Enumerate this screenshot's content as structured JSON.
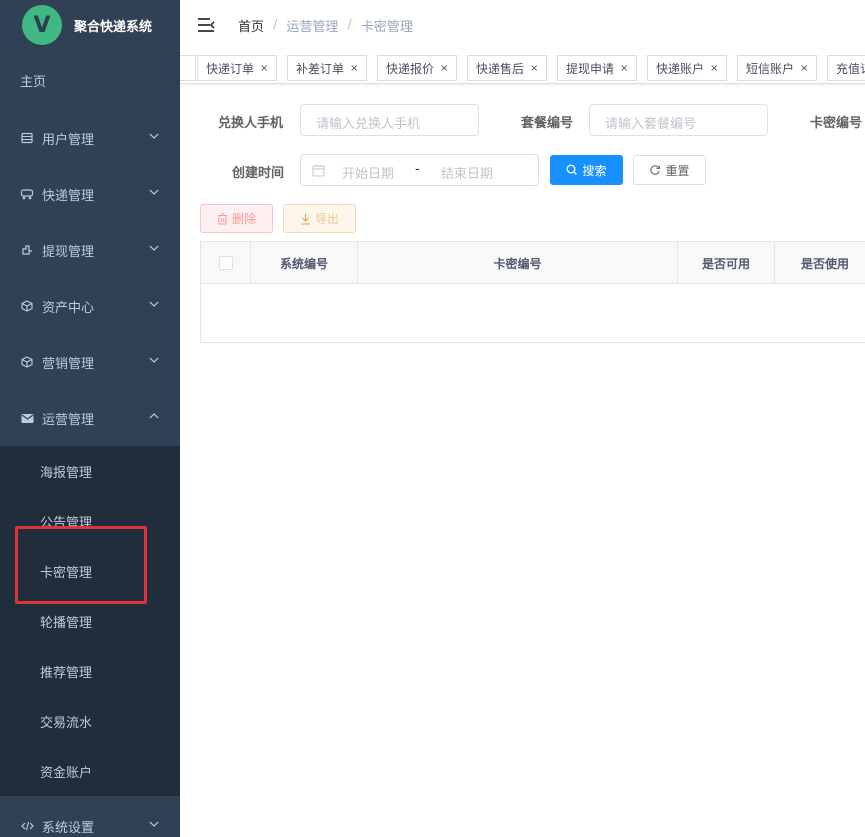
{
  "app": {
    "logo_letter": "V",
    "title": "聚合快递系统"
  },
  "sidebar": {
    "home": "主页",
    "items": [
      {
        "label": "用户管理",
        "icon": "table-icon"
      },
      {
        "label": "快递管理",
        "icon": "truck-icon"
      },
      {
        "label": "提现管理",
        "icon": "withdraw-icon"
      },
      {
        "label": "资产中心",
        "icon": "cube-icon"
      },
      {
        "label": "营销管理",
        "icon": "cube-icon"
      },
      {
        "label": "运营管理",
        "icon": "mail-icon"
      }
    ],
    "sub_items": [
      "海报管理",
      "公告管理",
      "卡密管理",
      "轮播管理",
      "推荐管理",
      "交易流水",
      "资金账户"
    ],
    "bottom_item": {
      "label": "系统设置",
      "icon": "code-icon"
    }
  },
  "breadcrumb": [
    "首页",
    "运营管理",
    "卡密管理"
  ],
  "tags": [
    "快递订单",
    "补差订单",
    "快递报价",
    "快递售后",
    "提现申请",
    "快递账户",
    "短信账户",
    "充值订单"
  ],
  "search": {
    "phone_label": "兑换人手机",
    "phone_placeholder": "请输入兑换人手机",
    "package_label": "套餐编号",
    "package_placeholder": "请输入套餐编号",
    "card_label": "卡密编号",
    "time_label": "创建时间",
    "start_placeholder": "开始日期",
    "range_sep": "-",
    "end_placeholder": "结束日期",
    "search_btn": "搜索",
    "reset_btn": "重置"
  },
  "toolbar": {
    "delete_btn": "删除",
    "export_btn": "导出"
  },
  "table": {
    "columns": [
      "系统编号",
      "卡密编号",
      "是否可用",
      "是否使用"
    ]
  },
  "colors": {
    "sidebar_bg": "#304156",
    "submenu_bg": "#1f2d3d",
    "primary": "#1890ff",
    "highlight": "#e0323b"
  }
}
